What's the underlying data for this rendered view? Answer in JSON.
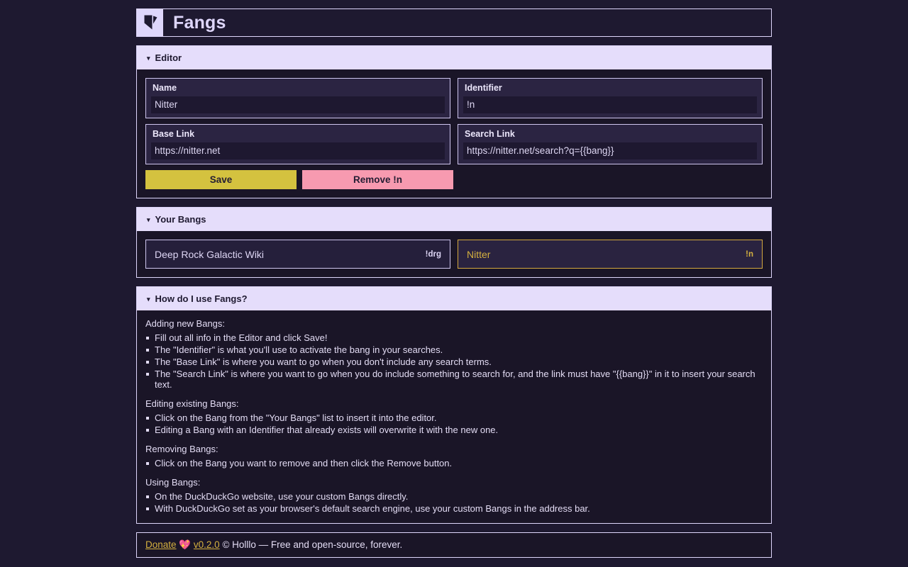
{
  "app": {
    "title": "Fangs",
    "logo_icon": "fang-logo-icon"
  },
  "editor": {
    "header": "Editor",
    "caret": "▾",
    "fields": [
      {
        "label": "Name",
        "value": "Nitter",
        "name": "name"
      },
      {
        "label": "Identifier",
        "value": "!n",
        "name": "identifier"
      },
      {
        "label": "Base Link",
        "value": "https://nitter.net",
        "name": "base-link"
      },
      {
        "label": "Search Link",
        "value": "https://nitter.net/search?q={{bang}}",
        "name": "search-link"
      }
    ],
    "save_label": "Save",
    "remove_label": "Remove !n"
  },
  "your_bangs": {
    "header": "Your Bangs",
    "caret": "▾",
    "items": [
      {
        "name": "Deep Rock Galactic Wiki",
        "identifier": "!drg",
        "selected": false
      },
      {
        "name": "Nitter",
        "identifier": "!n",
        "selected": true
      }
    ]
  },
  "help": {
    "header": "How do I use Fangs?",
    "caret": "▾",
    "groups": [
      {
        "heading": "Adding new Bangs:",
        "items": [
          "Fill out all info in the Editor and click Save!",
          "The \"Identifier\" is what you'll use to activate the bang in your searches.",
          "The \"Base Link\" is where you want to go when you don't include any search terms.",
          "The \"Search Link\" is where you want to go when you do include something to search for, and the link must have \"{{bang}}\" in it to insert your search text."
        ]
      },
      {
        "heading": "Editing existing Bangs:",
        "items": [
          "Click on the Bang from the \"Your Bangs\" list to insert it into the editor.",
          "Editing a Bang with an Identifier that already exists will overwrite it with the new one."
        ]
      },
      {
        "heading": "Removing Bangs:",
        "items": [
          "Click on the Bang you want to remove and then click the Remove button."
        ]
      },
      {
        "heading": "Using Bangs:",
        "items": [
          "On the DuckDuckGo website, use your custom Bangs directly.",
          "With DuckDuckGo set as your browser's default search engine, use your custom Bangs in the address bar."
        ]
      }
    ]
  },
  "footer": {
    "donate_label": "Donate",
    "heart_icon": "💖",
    "version_label": "v0.2.0",
    "tail": "© Holllo — Free and open-source, forever."
  },
  "colors": {
    "page_bg": "#1e1930",
    "panel_bg": "#1a1527",
    "accent_lavender": "#ded6fb",
    "accent_gold": "#d4b03f",
    "save_bg": "#d4c23f",
    "remove_bg": "#f79ab0"
  }
}
